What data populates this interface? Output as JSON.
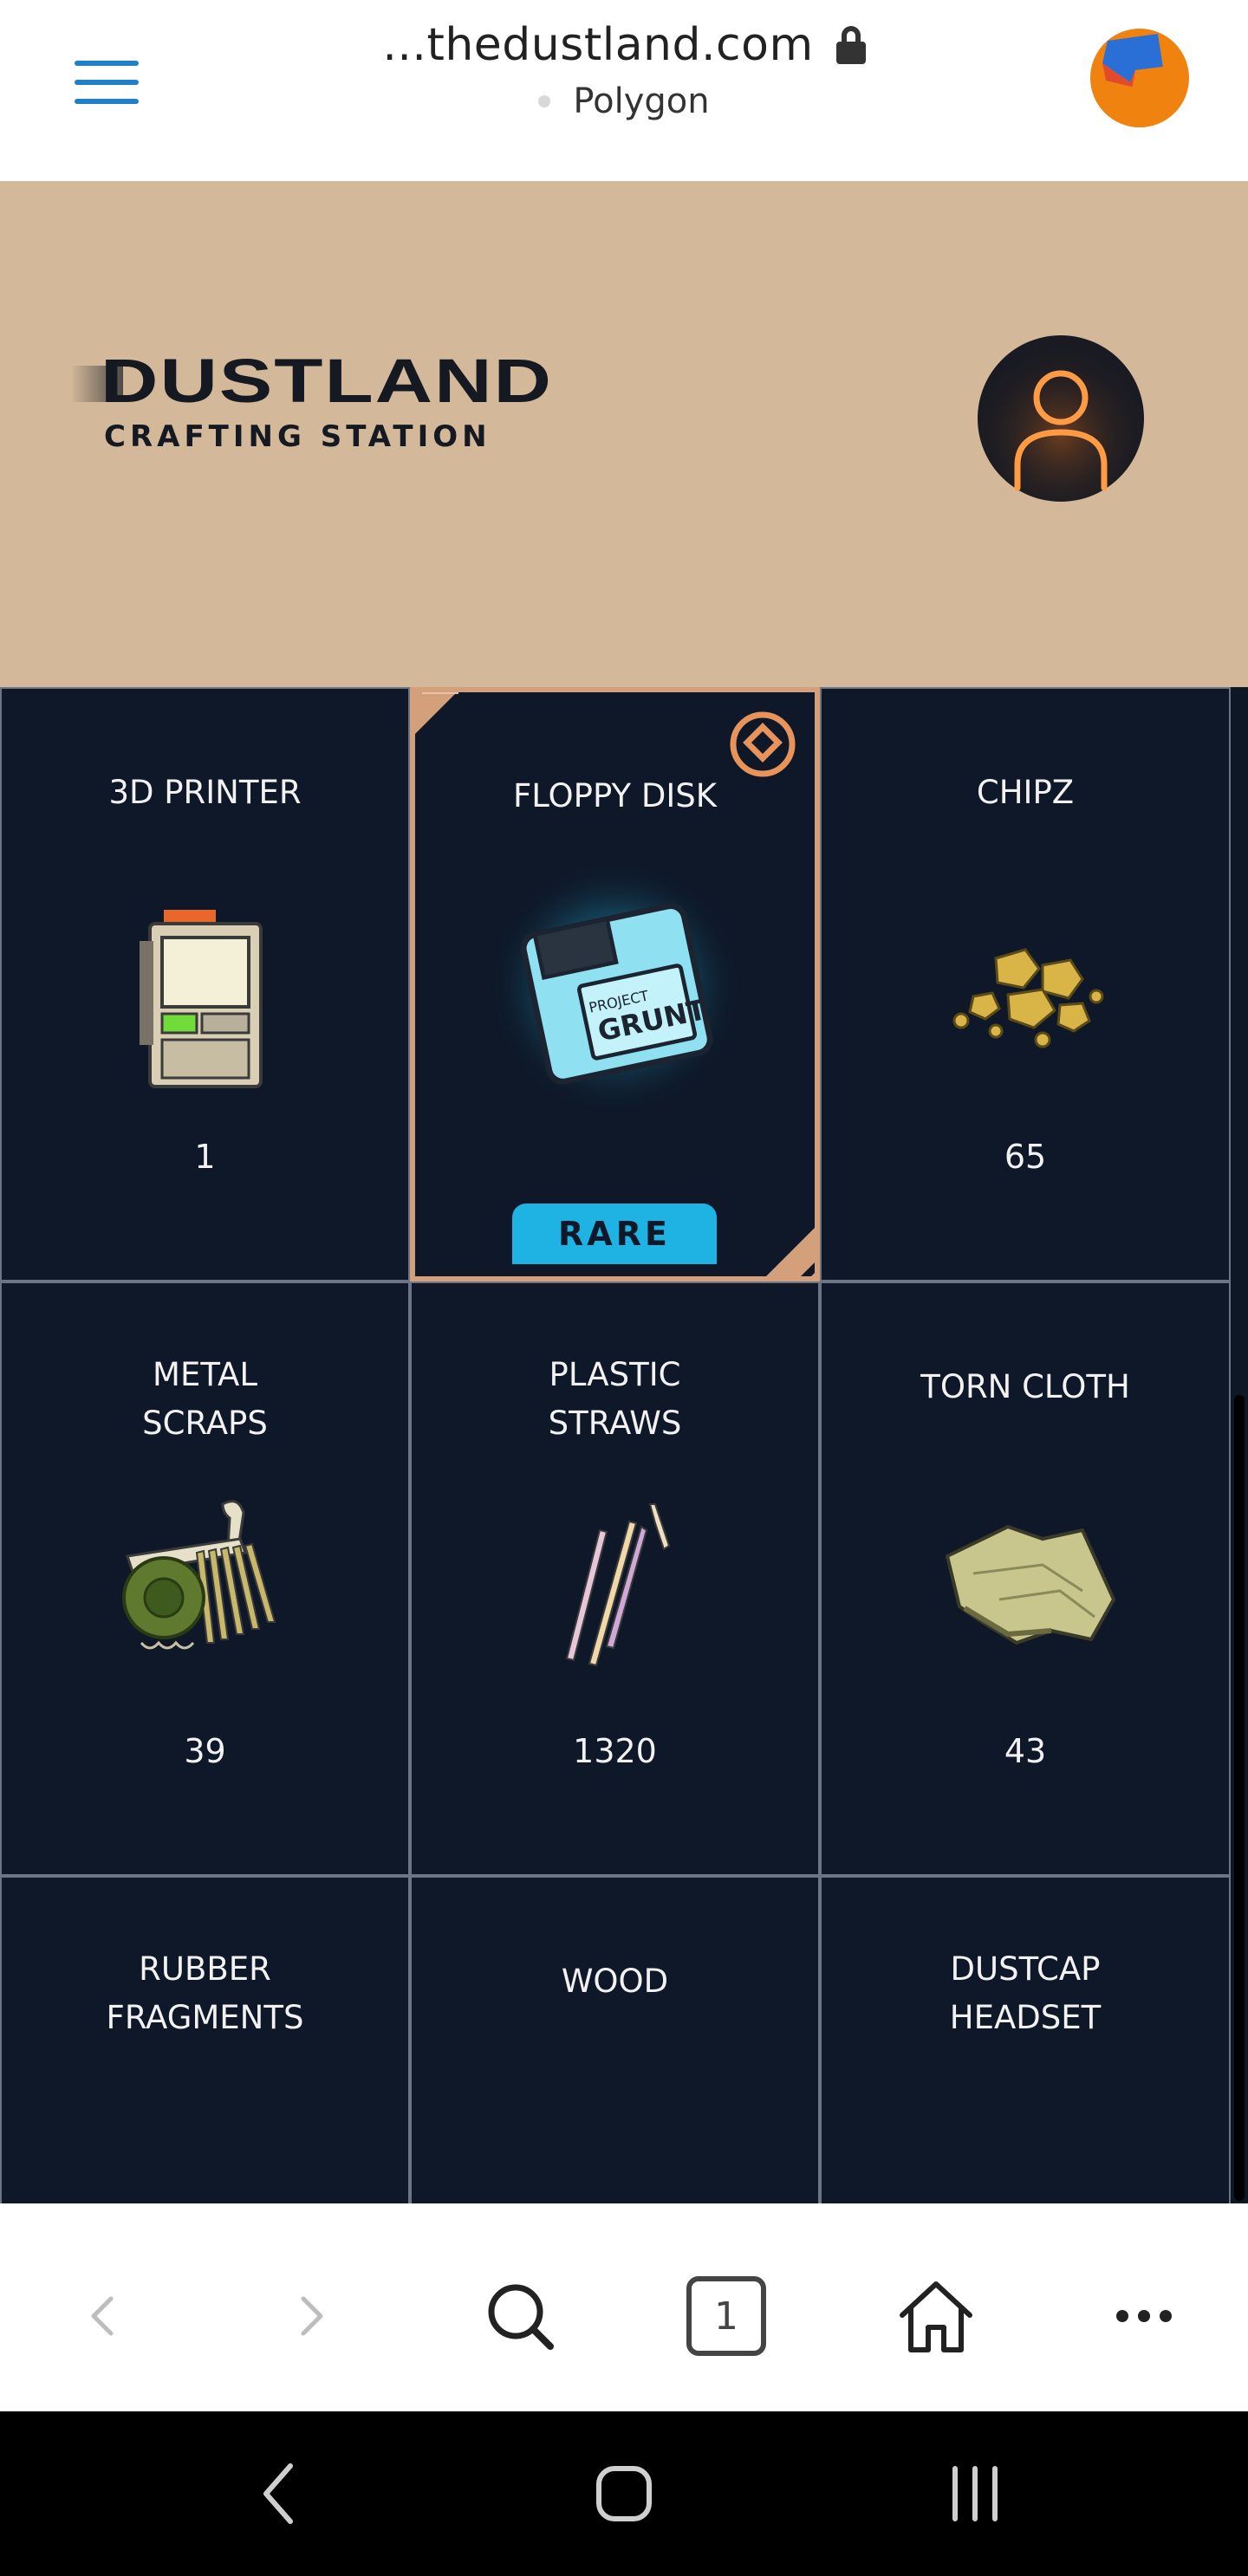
{
  "browser": {
    "url": "...thedustland.com",
    "network": "Polygon",
    "icons": {
      "menu": "hamburger-menu-icon",
      "lock": "lock-icon",
      "account": "account-avatar-icon"
    },
    "accent_color": "#1f7fc7",
    "account_color": "#f0830f"
  },
  "hero": {
    "logo_title": "DUSTLAND",
    "logo_subtitle": "CRAFTING STATION",
    "background_color": "#d3b89a",
    "profile_icon": "user-silhouette-icon"
  },
  "items": [
    {
      "name": "3D PRINTER",
      "count": "1",
      "art": "3d-printer-image"
    },
    {
      "name": "FLOPPY DISK",
      "count": "",
      "badge": "RARE",
      "art": "floppy-disk-image",
      "rare": true
    },
    {
      "name": "CHIPZ",
      "count": "65",
      "art": "chipz-image"
    },
    {
      "name": "METAL\nSCRAPS",
      "count": "39",
      "art": "metal-scraps-image"
    },
    {
      "name": "PLASTIC\nSTRAWS",
      "count": "1320",
      "art": "plastic-straws-image"
    },
    {
      "name": "TORN CLOTH",
      "count": "43",
      "art": "torn-cloth-image"
    },
    {
      "name": "RUBBER\nFRAGMENTS",
      "count": "",
      "art": "rubber-fragments-image"
    },
    {
      "name": "WOOD",
      "count": "",
      "art": "wood-image"
    },
    {
      "name": "DUSTCAP\nHEADSET",
      "count": "",
      "art": "dustcap-headset-image"
    }
  ],
  "toolbar": {
    "tabs_count": "1",
    "icons": [
      "back-icon",
      "forward-icon",
      "search-icon",
      "tabs-icon",
      "home-icon",
      "more-icon"
    ]
  },
  "android_nav": {
    "icons": [
      "nav-back-icon",
      "nav-home-icon",
      "nav-recents-icon"
    ]
  },
  "colors": {
    "card_bg": "#0e1828",
    "rare_border": "#d4a07c",
    "rare_badge": "#1fb3e3"
  }
}
